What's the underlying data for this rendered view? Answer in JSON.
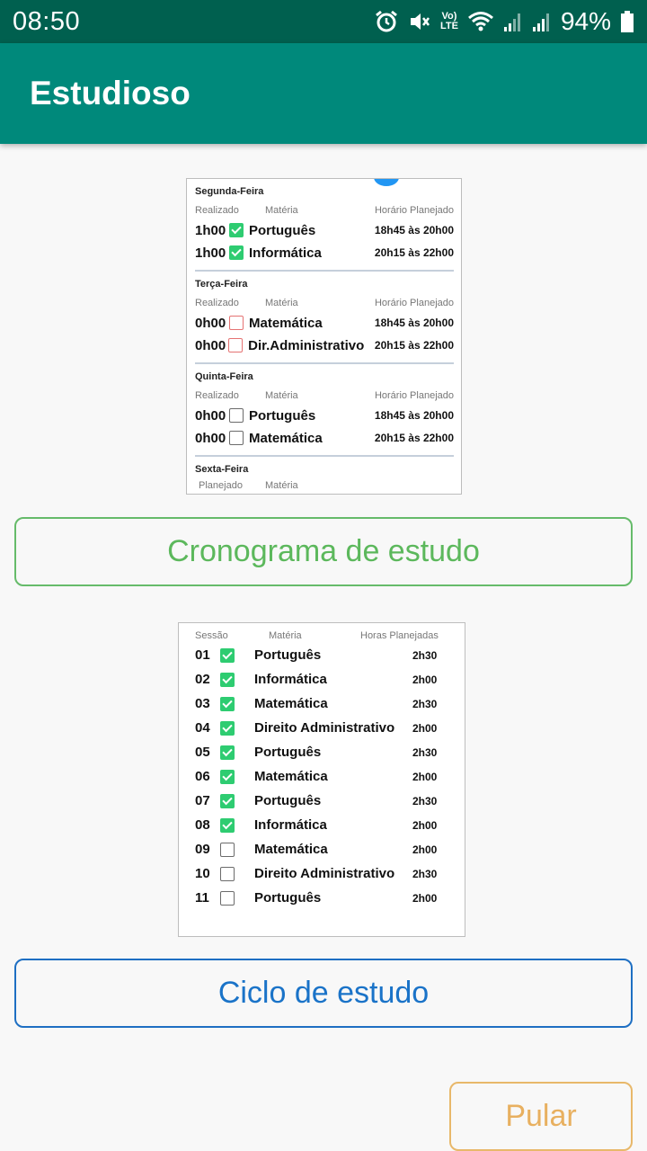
{
  "status": {
    "time": "08:50",
    "battery": "94%",
    "lte_top": "Vo)",
    "lte_bottom": "LTE"
  },
  "appbar": {
    "title": "Estudioso"
  },
  "cronograma_preview": {
    "days": [
      {
        "title": "Segunda-Feira",
        "headers": [
          "Realizado",
          "Matéria",
          "Horário Planejado"
        ],
        "rows": [
          {
            "dur": "1h00",
            "state": "checked",
            "subject": "Português",
            "time": "18h45 às 20h00"
          },
          {
            "dur": "1h00",
            "state": "checked",
            "subject": "Informática",
            "time": "20h15 às 22h00"
          }
        ]
      },
      {
        "title": "Terça-Feira",
        "headers": [
          "Realizado",
          "Matéria",
          "Horário Planejado"
        ],
        "rows": [
          {
            "dur": "0h00",
            "state": "red",
            "subject": "Matemática",
            "time": "18h45 às 20h00"
          },
          {
            "dur": "0h00",
            "state": "red",
            "subject": "Dir.Administrativo",
            "time": "20h15 às 22h00"
          }
        ]
      },
      {
        "title": "Quinta-Feira",
        "headers": [
          "Realizado",
          "Matéria",
          "Horário Planejado"
        ],
        "rows": [
          {
            "dur": "0h00",
            "state": "empty",
            "subject": "Português",
            "time": "18h45 às 20h00"
          },
          {
            "dur": "0h00",
            "state": "empty",
            "subject": "Matemática",
            "time": "20h15 às 22h00"
          }
        ]
      }
    ],
    "last_day": {
      "title": "Sexta-Feira",
      "headers": [
        "Planejado",
        "Matéria"
      ]
    }
  },
  "buttons": {
    "cronograma": "Cronograma de estudo",
    "ciclo": "Ciclo de estudo",
    "pular": "Pular"
  },
  "ciclo_preview": {
    "headers": [
      "Sessão",
      "Matéria",
      "Horas Planejadas"
    ],
    "rows": [
      {
        "num": "01",
        "checked": true,
        "subject": "Português",
        "hours": "2h30"
      },
      {
        "num": "02",
        "checked": true,
        "subject": "Informática",
        "hours": "2h00"
      },
      {
        "num": "03",
        "checked": true,
        "subject": "Matemática",
        "hours": "2h30"
      },
      {
        "num": "04",
        "checked": true,
        "subject": "Direito Administrativo",
        "hours": "2h00"
      },
      {
        "num": "05",
        "checked": true,
        "subject": "Português",
        "hours": "2h30"
      },
      {
        "num": "06",
        "checked": true,
        "subject": "Matemática",
        "hours": "2h00"
      },
      {
        "num": "07",
        "checked": true,
        "subject": "Português",
        "hours": "2h30"
      },
      {
        "num": "08",
        "checked": true,
        "subject": "Informática",
        "hours": "2h00"
      },
      {
        "num": "09",
        "checked": false,
        "subject": "Matemática",
        "hours": "2h00"
      },
      {
        "num": "10",
        "checked": false,
        "subject": "Direito Administrativo",
        "hours": "2h30"
      },
      {
        "num": "11",
        "checked": false,
        "subject": "Português",
        "hours": "2h00"
      }
    ]
  }
}
